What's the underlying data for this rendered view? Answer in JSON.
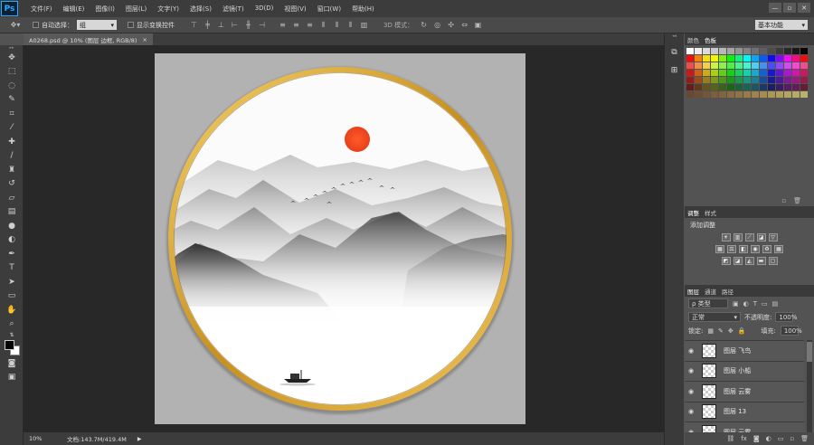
{
  "app": {
    "logo": "Ps"
  },
  "menu": [
    "文件(F)",
    "编辑(E)",
    "图像(I)",
    "图层(L)",
    "文字(Y)",
    "选择(S)",
    "滤镜(T)",
    "3D(D)",
    "视图(V)",
    "窗口(W)",
    "帮助(H)"
  ],
  "window_controls": [
    "—",
    "▫",
    "✕"
  ],
  "options": {
    "auto_select_label": "自动选择：",
    "auto_select_value": "组",
    "show_transform_label": "显示变换控件",
    "mode_3d_label": "3D 模式：",
    "workspace": "基本功能"
  },
  "document_tab": {
    "title": "A0268.psd @ 10% (图层 边框, RGB/8)",
    "close": "×"
  },
  "status": {
    "zoom": "10%",
    "doc_size": "文档:143.7M/419.4M",
    "arrow": "▶"
  },
  "panels": {
    "color_tabs": [
      "颜色",
      "色板"
    ],
    "adjust_tabs": [
      "调整",
      "样式"
    ],
    "adjust_title": "添加调整",
    "layers_tabs": [
      "图层",
      "通道",
      "路径"
    ],
    "filter_kind": "ρ 类型",
    "blend_mode": "正常",
    "opacity_label": "不透明度:",
    "opacity_value": "100%",
    "lock_label": "锁定:",
    "fill_label": "填充:",
    "fill_value": "100%",
    "layers": [
      "图层 飞鸟",
      "图层 小船",
      "图层 云雾",
      "图层 13",
      "图层 云雾"
    ],
    "footer_fx": "fx"
  }
}
